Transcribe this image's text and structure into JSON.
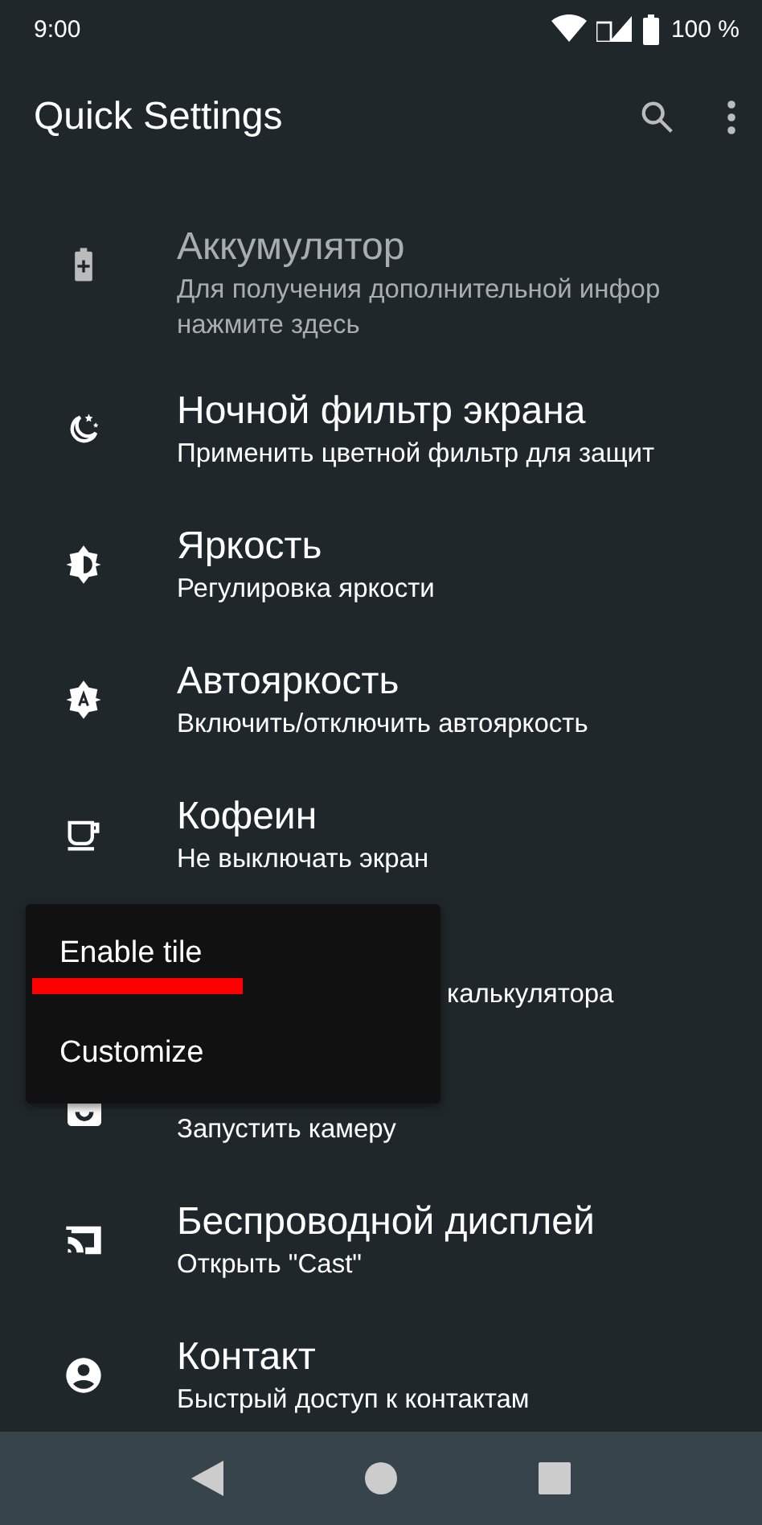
{
  "status_bar": {
    "time": "9:00",
    "battery": "100 %"
  },
  "app_bar": {
    "title": "Quick Settings"
  },
  "tiles": [
    {
      "kind": "battery",
      "title": "Аккумулятор",
      "subtitle": "Для получения дополнительной инфор\nнажмите здесь",
      "disabled": true
    },
    {
      "kind": "night",
      "title": "Ночной фильтр экрана",
      "subtitle": "Применить цветной фильтр для защит",
      "disabled": false
    },
    {
      "kind": "brightness",
      "title": "Яркость",
      "subtitle": "Регулировка яркости",
      "disabled": false
    },
    {
      "kind": "auto",
      "title": "Автояркость",
      "subtitle": "Включить/отключить автояркость",
      "disabled": false
    },
    {
      "kind": "coffee",
      "title": "Кофеин",
      "subtitle": "Не выключать экран",
      "disabled": false
    },
    {
      "kind": "covered",
      "subtitle": "калькулятора",
      "disabled": false
    },
    {
      "kind": "camera",
      "subtitle": "Запустить камеру",
      "disabled": false
    },
    {
      "kind": "cast",
      "title": "Беспроводной дисплей",
      "subtitle": "Открыть \"Cast\"",
      "disabled": false
    },
    {
      "kind": "contact",
      "title": "Контакт",
      "subtitle": "Быстрый доступ к контактам",
      "disabled": false
    }
  ],
  "menu": {
    "items": [
      {
        "label": "Enable tile",
        "marked": true
      },
      {
        "label": "Customize",
        "marked": false
      }
    ]
  }
}
